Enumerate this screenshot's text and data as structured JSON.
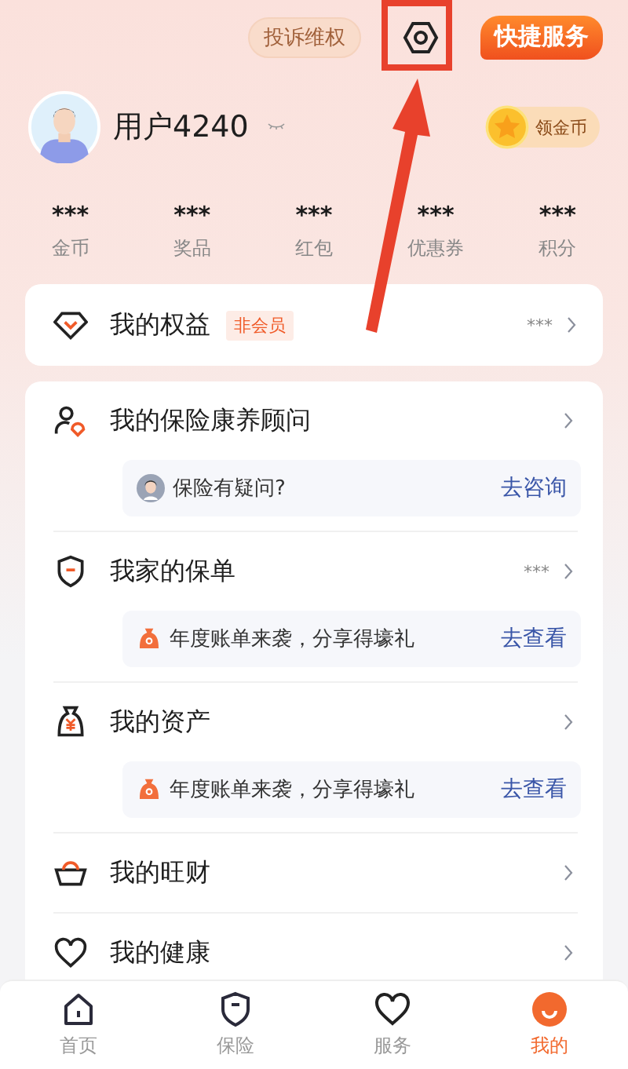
{
  "header": {
    "complaint_button": "投诉维权",
    "quick_service_button": "快捷服务"
  },
  "profile": {
    "name": "用户4240",
    "coin_button": "领金币"
  },
  "stats": [
    {
      "value": "***",
      "label": "金币"
    },
    {
      "value": "***",
      "label": "奖品"
    },
    {
      "value": "***",
      "label": "红包"
    },
    {
      "value": "***",
      "label": "优惠券"
    },
    {
      "value": "***",
      "label": "积分"
    }
  ],
  "rights_card": {
    "title": "我的权益",
    "badge": "非会员",
    "value": "***"
  },
  "menu": [
    {
      "kind": "advisor",
      "title": "我的保险康养顾问",
      "banner": {
        "kind": "person",
        "text": "保险有疑问?",
        "action": "去咨询"
      }
    },
    {
      "kind": "shield",
      "title": "我家的保单",
      "value": "***",
      "banner": {
        "kind": "bag",
        "text": "年度账单来袭，分享得壕礼",
        "action": "去查看"
      }
    },
    {
      "kind": "money",
      "title": "我的资产",
      "banner": {
        "kind": "bag",
        "text": "年度账单来袭，分享得壕礼",
        "action": "去查看"
      }
    },
    {
      "kind": "ingot",
      "title": "我的旺财"
    },
    {
      "kind": "heart",
      "title": "我的健康"
    }
  ],
  "tabbar": [
    {
      "kind": "home",
      "label": "首页",
      "selected": false
    },
    {
      "kind": "shield",
      "label": "保险",
      "selected": false
    },
    {
      "kind": "heart",
      "label": "服务",
      "selected": false
    },
    {
      "kind": "smile",
      "label": "我的",
      "selected": true
    }
  ]
}
